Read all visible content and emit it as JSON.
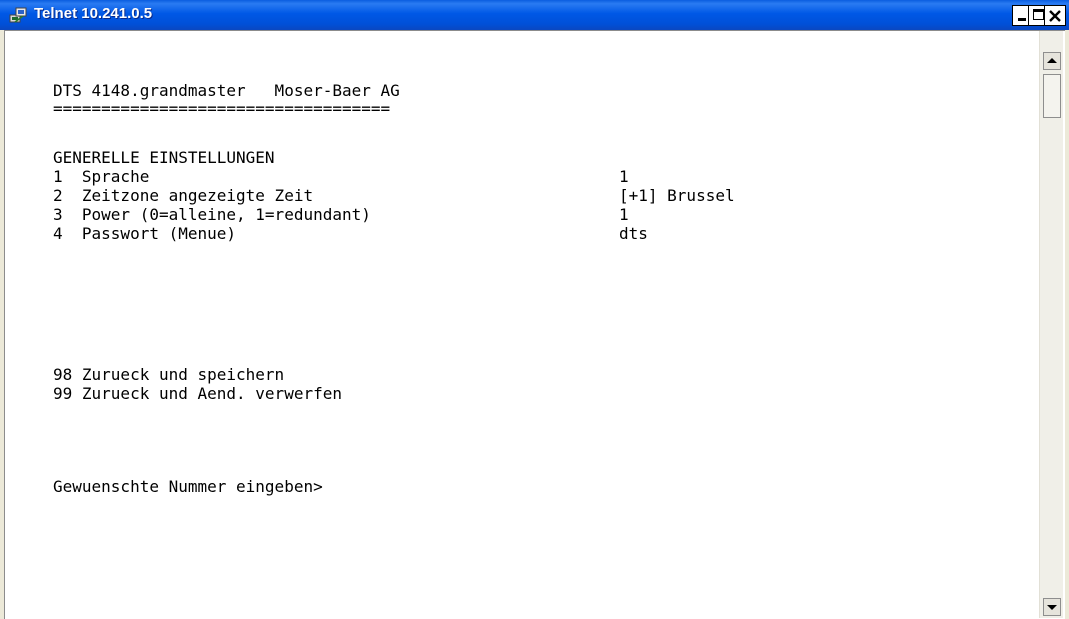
{
  "window": {
    "title": "Telnet 10.241.0.5",
    "icon": "telnet-app-icon",
    "controls": [
      "minimize-icon",
      "maximize-icon",
      "close-icon"
    ]
  },
  "terminal": {
    "header": "DTS 4148.grandmaster   Moser-Baer AG",
    "separator": "===================================",
    "section_title": "GENERELLE EINSTELLUNGEN",
    "settings": [
      {
        "label": "1  Sprache",
        "value": "1"
      },
      {
        "label": "2  Zeitzone angezeigte Zeit",
        "value": "[+1] Brussel"
      },
      {
        "label": "3  Power (0=alleine, 1=redundant)",
        "value": "1"
      },
      {
        "label": "4  Passwort (Menue)",
        "value": "dts"
      }
    ],
    "actions": [
      "98 Zurueck und speichern",
      "99 Zurueck und Aend. verwerfen"
    ],
    "prompt": "Gewuenschte Nummer eingeben>"
  },
  "colors": {
    "titlebar": "#0058e6",
    "terminal_bg": "#ffffff",
    "terminal_text": "#000000"
  }
}
